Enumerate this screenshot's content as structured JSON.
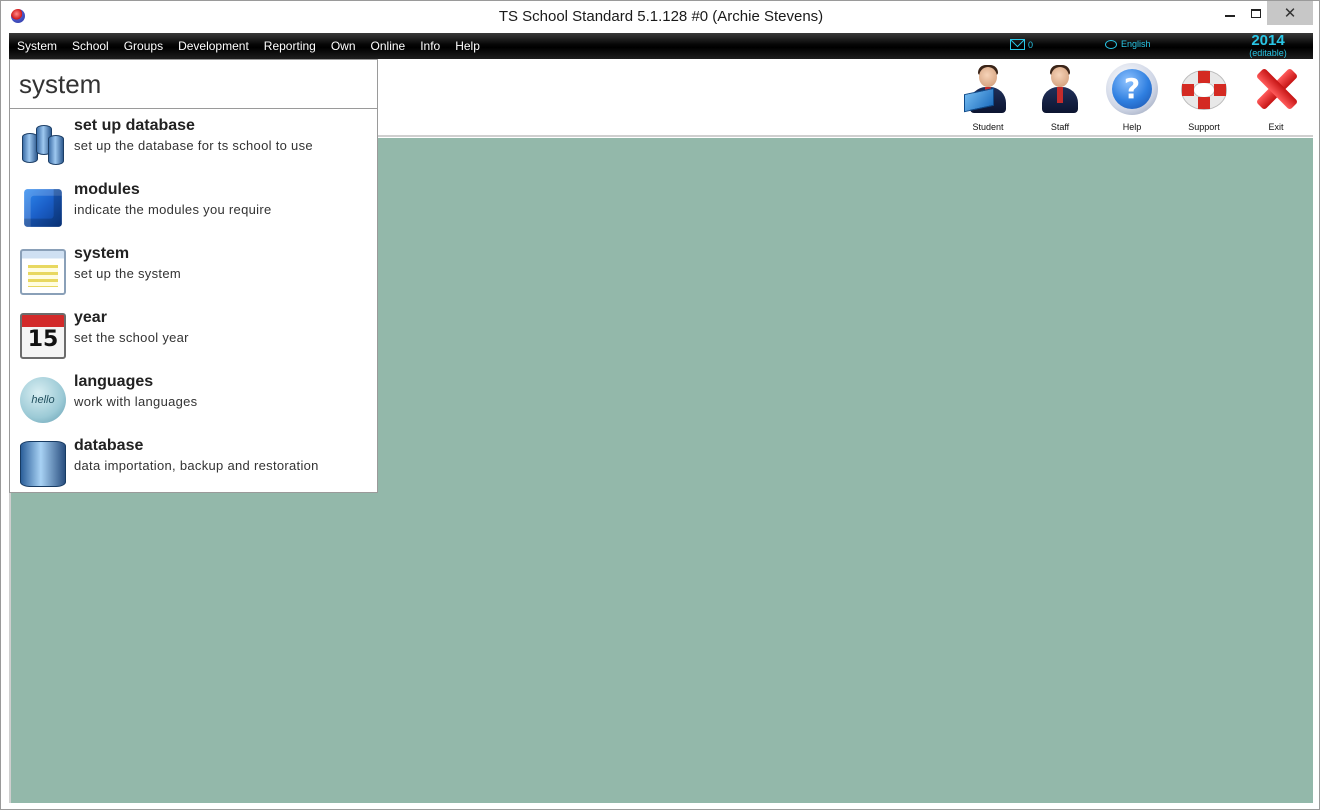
{
  "window": {
    "title": "TS School Standard 5.1.128 #0 (Archie Stevens)",
    "close_glyph": "✕"
  },
  "menubar": {
    "items": [
      "System",
      "School",
      "Groups",
      "Development",
      "Reporting",
      "Own",
      "Online",
      "Info",
      "Help"
    ],
    "mail_count": "0",
    "language": "English",
    "year": "2014",
    "year_note": "(editable)"
  },
  "toolbar": {
    "buttons": [
      {
        "label": "Student",
        "icon": "student-icon"
      },
      {
        "label": "Staff",
        "icon": "staff-icon"
      },
      {
        "label": "Help",
        "icon": "help-icon",
        "glyph": "?"
      },
      {
        "label": "Support",
        "icon": "lifebuoy-icon"
      },
      {
        "label": "Exit",
        "icon": "exit-x-icon"
      }
    ]
  },
  "panel": {
    "title": "system",
    "items": [
      {
        "title": "set up database",
        "desc": "set up the database for ts school to use",
        "icon": "database-setup-icon"
      },
      {
        "title": "modules",
        "desc": "indicate the modules you require",
        "icon": "cube-icon"
      },
      {
        "title": "system",
        "desc": "set up the system",
        "icon": "system-window-icon"
      },
      {
        "title": "year",
        "desc": "set the school year",
        "icon": "calendar-icon",
        "glyph": "15"
      },
      {
        "title": "languages",
        "desc": "work with languages",
        "icon": "speech-bubble-icon",
        "glyph": "hello"
      },
      {
        "title": "database",
        "desc": "data importation, backup and restoration",
        "icon": "database-icon"
      }
    ]
  },
  "colors": {
    "workspace": "#93b8aa",
    "menubar": "#000000",
    "accent": "#29c6e6"
  }
}
